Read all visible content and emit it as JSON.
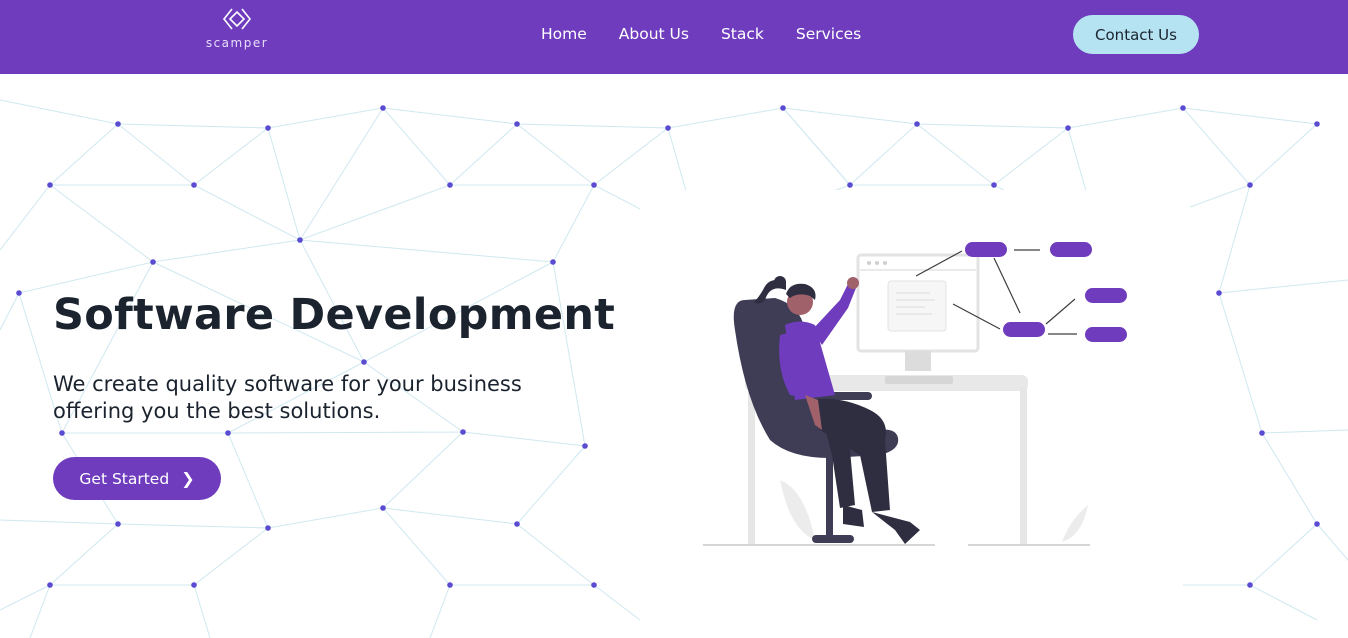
{
  "brand": {
    "name": "scamper"
  },
  "nav": {
    "items": [
      "Home",
      "About Us",
      "Stack",
      "Services"
    ],
    "contact_label": "Contact Us"
  },
  "hero": {
    "title": "Software Development",
    "subtitle": "We create quality software for your business offering you the best solutions.",
    "cta_label": "Get Started",
    "cta_icon": "chevron-right-icon"
  },
  "colors": {
    "primary": "#6f3cbd",
    "contact_button": "#b5e3f1",
    "text": "#1b232e",
    "network_node": "#5b4bd1",
    "network_line": "#cfe8f0"
  }
}
